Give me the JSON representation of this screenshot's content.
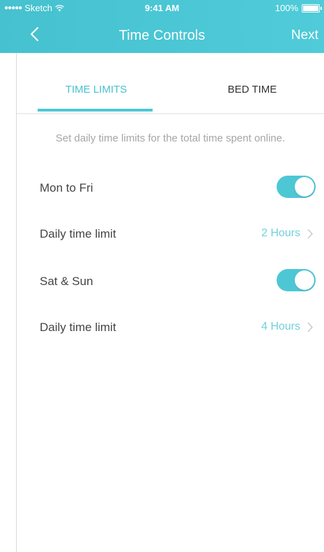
{
  "status_bar": {
    "carrier": "Sketch",
    "time": "9:41 AM",
    "battery": "100%"
  },
  "header": {
    "title": "Time Controls",
    "next_label": "Next"
  },
  "tabs": [
    {
      "label": "TIME LIMITS",
      "active": true
    },
    {
      "label": "BED TIME",
      "active": false
    }
  ],
  "hint": "Set daily time limits for the total time spent online.",
  "schedules": [
    {
      "label": "Mon to Fri",
      "enabled": true,
      "limit_label": "Daily time limit",
      "limit_value": "2 Hours"
    },
    {
      "label": "Sat & Sun",
      "enabled": true,
      "limit_label": "Daily time limit",
      "limit_value": "4 Hours"
    }
  ],
  "colors": {
    "accent": "#4ec7d5",
    "hint_text": "#a6a6a6",
    "body_text": "#444444"
  }
}
